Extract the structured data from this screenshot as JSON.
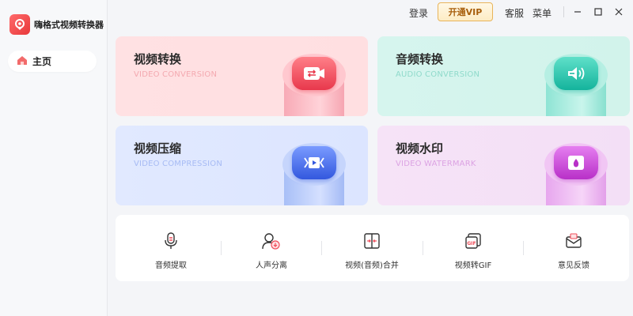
{
  "app": {
    "name": "嗨格式视频转换器"
  },
  "sidebar": {
    "home_label": "主页"
  },
  "topbar": {
    "login": "登录",
    "vip": "开通VIP",
    "service": "客服",
    "menu": "菜单"
  },
  "cards": [
    {
      "title": "视频转换",
      "subtitle": "VIDEO CONVERSION",
      "icon": "video-convert-icon",
      "accent": "#f0485a"
    },
    {
      "title": "音频转换",
      "subtitle": "AUDIO CONVERSION",
      "icon": "audio-convert-icon",
      "accent": "#1fbfa8"
    },
    {
      "title": "视频压缩",
      "subtitle": "VIDEO COMPRESSION",
      "icon": "video-compress-icon",
      "accent": "#3d68e8"
    },
    {
      "title": "视频水印",
      "subtitle": "VIDEO WATERMARK",
      "icon": "video-watermark-icon",
      "accent": "#c93fd6"
    }
  ],
  "tools": [
    {
      "label": "音频提取",
      "icon": "microphone-icon"
    },
    {
      "label": "人声分离",
      "icon": "voice-separation-icon"
    },
    {
      "label": "视频(音频)合并",
      "icon": "merge-icon"
    },
    {
      "label": "视频转GIF",
      "icon": "gif-icon"
    },
    {
      "label": "意见反馈",
      "icon": "mail-icon"
    }
  ],
  "colors": {
    "brand": "#e8383a",
    "vip_text": "#a85f0c"
  }
}
